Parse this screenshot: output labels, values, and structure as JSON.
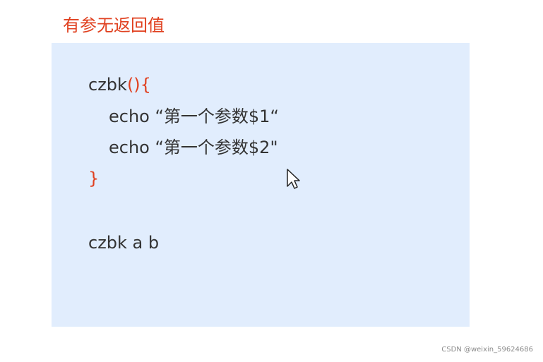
{
  "heading": "有参无返回值",
  "code": {
    "line1_name": "czbk",
    "line1_braces": "(){",
    "line2": "echo “第一个参数$1“",
    "line3": "echo “第一个参数$2\"",
    "line4_brace": "}",
    "line5": "czbk a b"
  },
  "watermark": "CSDN @weixin_59624686",
  "icons": {
    "cursor": "mouse-pointer-icon"
  },
  "colors": {
    "accent_red": "#e0401f",
    "code_background": "#e1edfd",
    "text": "#333333"
  }
}
